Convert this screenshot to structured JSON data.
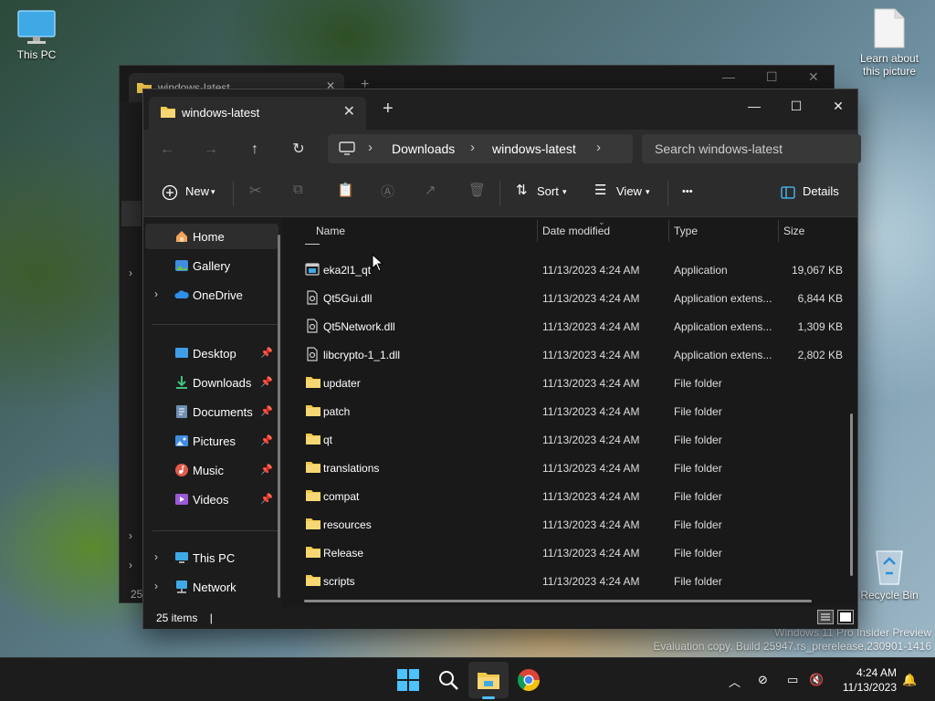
{
  "desktop": {
    "this_pc_label": "This PC",
    "learn_label": "Learn about this picture",
    "recycle_label": "Recycle Bin",
    "watermark_line1": "Windows 11 Pro Insider Preview",
    "watermark_line2": "Evaluation copy. Build 25947.rs_prerelease.230901-1416"
  },
  "bg_window": {
    "tab_title": "windows-latest",
    "side_count": "25"
  },
  "window": {
    "tab_title": "windows-latest",
    "new_tab": "+",
    "minimize": "—",
    "maximize": "☐",
    "close": "✕"
  },
  "address": {
    "crumbs": [
      "Downloads",
      "windows-latest"
    ],
    "search_placeholder": "Search windows-latest"
  },
  "toolbar": {
    "new_label": "New",
    "sort_label": "Sort",
    "view_label": "View",
    "more_label": "•••",
    "details_label": "Details"
  },
  "nav": {
    "home": "Home",
    "gallery": "Gallery",
    "onedrive": "OneDrive",
    "desktop": "Desktop",
    "downloads": "Downloads",
    "documents": "Documents",
    "pictures": "Pictures",
    "music": "Music",
    "videos": "Videos",
    "this_pc": "This PC",
    "network": "Network"
  },
  "columns": {
    "name": "Name",
    "date": "Date modified",
    "type": "Type",
    "size": "Size"
  },
  "files": [
    {
      "name": "eka2l1_qt",
      "date": "11/13/2023 4:24 AM",
      "type": "Application",
      "size": "19,067 KB",
      "kind": "app"
    },
    {
      "name": "Qt5Gui.dll",
      "date": "11/13/2023 4:24 AM",
      "type": "Application extens...",
      "size": "6,844 KB",
      "kind": "dll"
    },
    {
      "name": "Qt5Network.dll",
      "date": "11/13/2023 4:24 AM",
      "type": "Application extens...",
      "size": "1,309 KB",
      "kind": "dll"
    },
    {
      "name": "libcrypto-1_1.dll",
      "date": "11/13/2023 4:24 AM",
      "type": "Application extens...",
      "size": "2,802 KB",
      "kind": "dll"
    },
    {
      "name": "updater",
      "date": "11/13/2023 4:24 AM",
      "type": "File folder",
      "size": "",
      "kind": "folder"
    },
    {
      "name": "patch",
      "date": "11/13/2023 4:24 AM",
      "type": "File folder",
      "size": "",
      "kind": "folder"
    },
    {
      "name": "qt",
      "date": "11/13/2023 4:24 AM",
      "type": "File folder",
      "size": "",
      "kind": "folder"
    },
    {
      "name": "translations",
      "date": "11/13/2023 4:24 AM",
      "type": "File folder",
      "size": "",
      "kind": "folder"
    },
    {
      "name": "compat",
      "date": "11/13/2023 4:24 AM",
      "type": "File folder",
      "size": "",
      "kind": "folder"
    },
    {
      "name": "resources",
      "date": "11/13/2023 4:24 AM",
      "type": "File folder",
      "size": "",
      "kind": "folder"
    },
    {
      "name": "Release",
      "date": "11/13/2023 4:24 AM",
      "type": "File folder",
      "size": "",
      "kind": "folder"
    },
    {
      "name": "scripts",
      "date": "11/13/2023 4:24 AM",
      "type": "File folder",
      "size": "",
      "kind": "folder"
    }
  ],
  "status": {
    "item_count": "25 items",
    "cursor": "|"
  },
  "taskbar": {
    "time": "4:24 AM",
    "date": "11/13/2023"
  },
  "colors": {
    "folder": "#f2c94c",
    "accent": "#4cc2ff",
    "bg": "#191919"
  }
}
